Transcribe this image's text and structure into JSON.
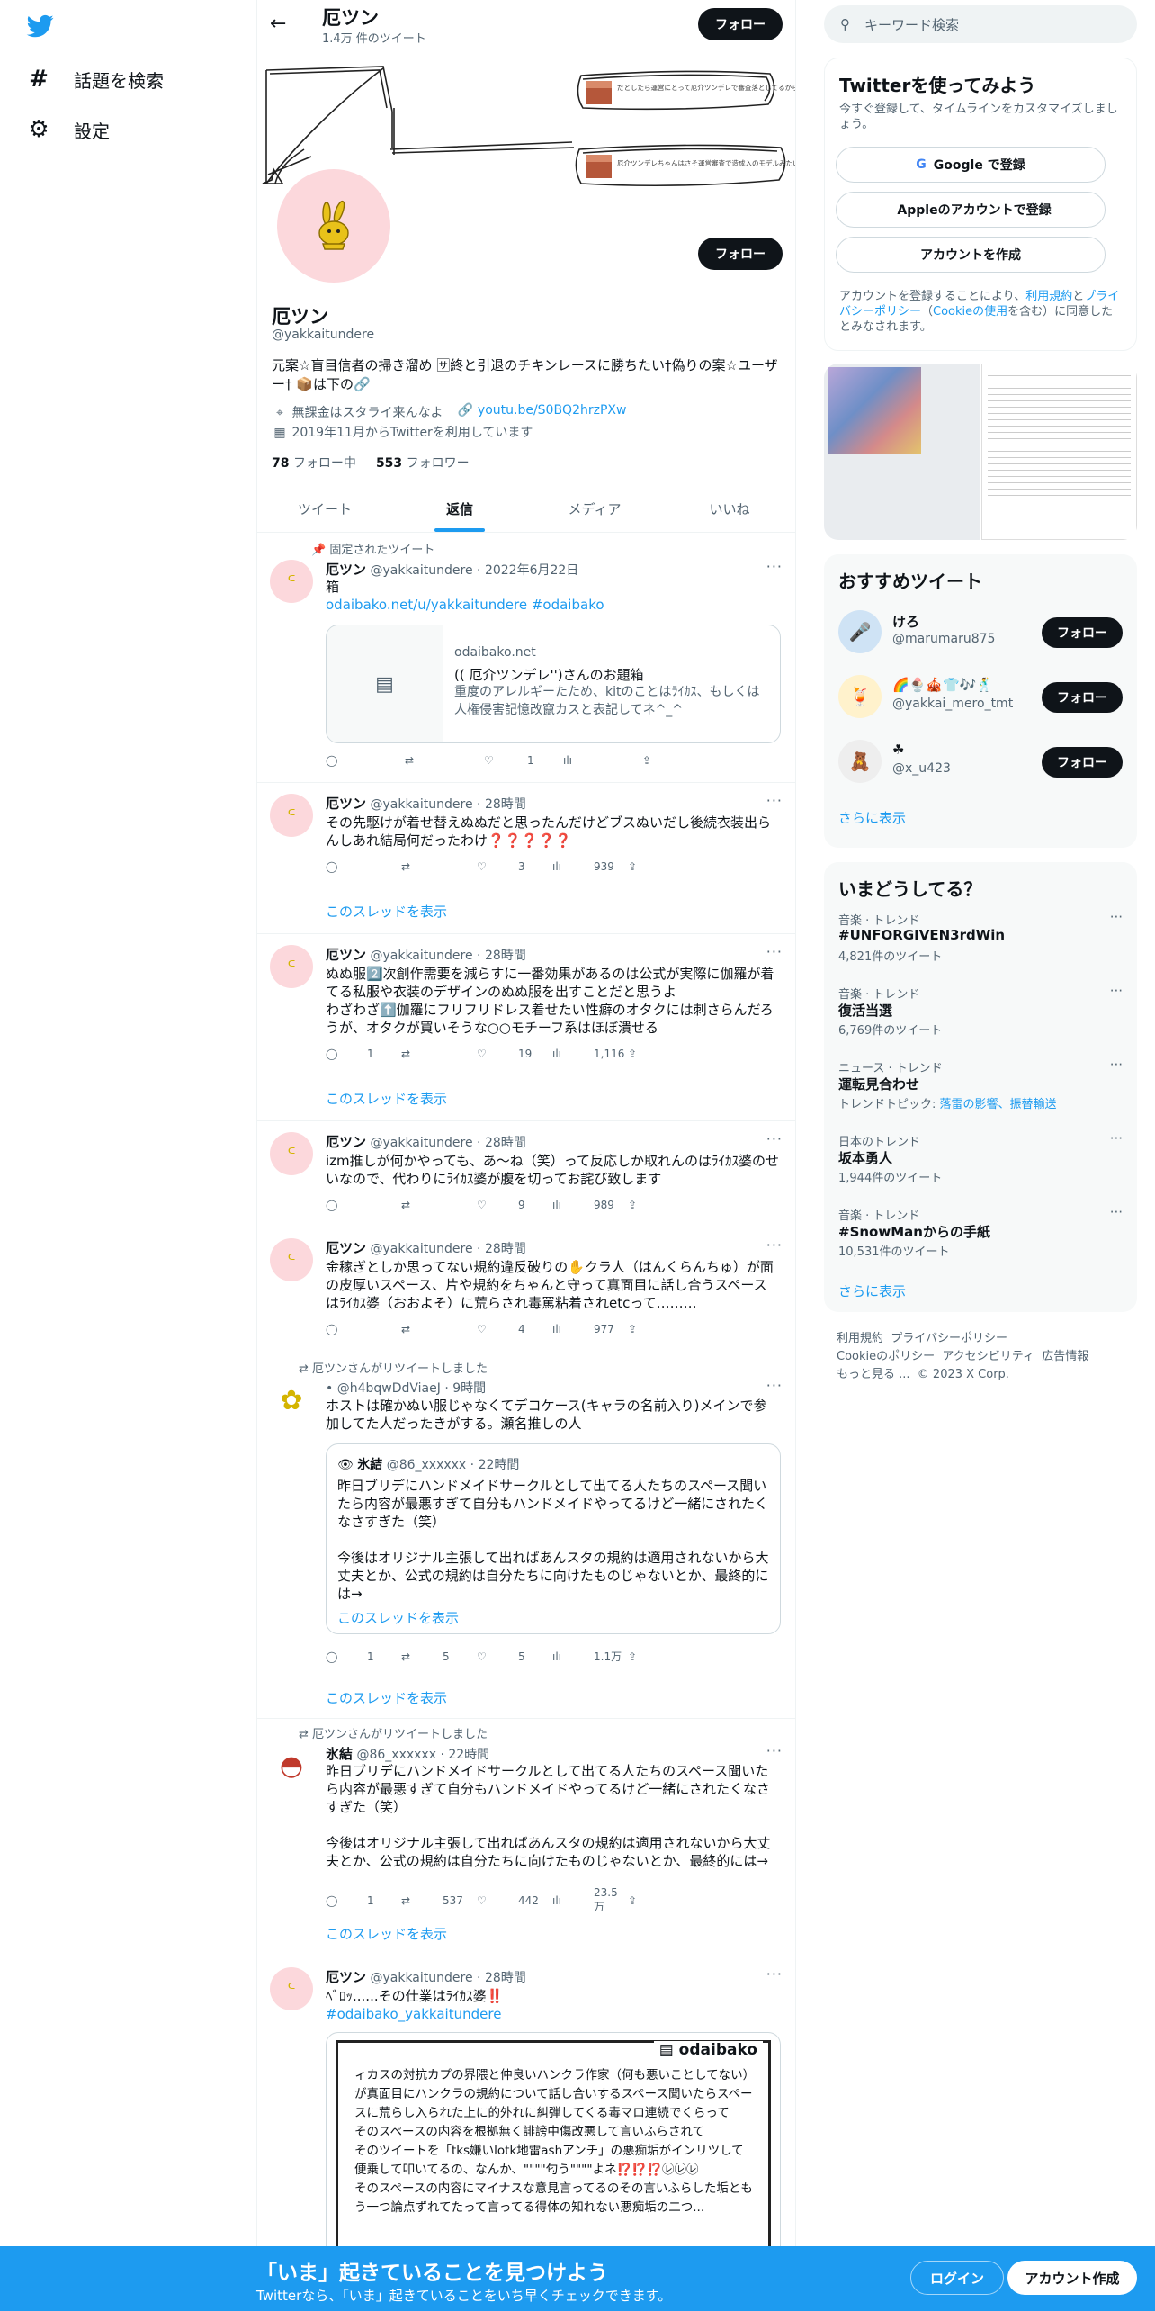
{
  "nav": {
    "items": [
      {
        "icon": "hashtag-icon",
        "glyph": "#",
        "label": "話題を検索"
      },
      {
        "icon": "gear-icon",
        "glyph": "⚙",
        "label": "設定"
      }
    ]
  },
  "header": {
    "name": "厄ツン",
    "tweet_count": "1.4万 件のツイート",
    "follow": "フォロー"
  },
  "banner": {
    "text1": "だとしたら運営にとって厄介ツンデレで審査落としてるから運営に晒はないか一笑",
    "text2": "厄介ツンデレちゃんはさそ運営審査で造成入のモデルみたいな運営が居らなのかもしれ"
  },
  "profile": {
    "avatar_glyph": "ᒼ",
    "name": "厄ツン",
    "handle": "@yakkaitundere",
    "follow": "フォロー",
    "bio": "元案☆盲目信者の掃き溜め 🈂終と引退のチキンレースに勝ちたい†偽りの案☆ユーザー† 📦は下の🔗",
    "location": "無課金はスタライ来んなよ",
    "url": "youtu.be/S0BQ2hrzPXw",
    "joined": "2019年11月からTwitterを利用しています",
    "following_count": "78",
    "following_label": "フォロー中",
    "followers_count": "553",
    "followers_label": "フォロワー"
  },
  "tabs": [
    "ツイート",
    "返信",
    "メディア",
    "いいね"
  ],
  "tweets": [
    {
      "context": "固定されたツイート",
      "name": "厄ツン",
      "handle": "@yakkaitundere",
      "time": "2022年6月22日",
      "text": "箱",
      "links": "odaibako.net/u/yakkaitundere #odaibako",
      "card": {
        "domain": "odaibako.net",
        "title": "(( 厄介ツンデレ'')さんのお題箱",
        "desc": "重度のアレルギーたため、kitのことはﾗｲｶｽ、もしくは人権侵害記憶改竄カスと表記してネ^_^"
      },
      "replies": "",
      "retweets": "",
      "likes": "1",
      "views": ""
    },
    {
      "name": "厄ツン",
      "handle": "@yakkaitundere",
      "time": "28時間",
      "text": "その先駆けが着せ替えぬぬだと思ったんだけどブスぬいだし後続衣装出らんしあれ結局何だったわけ❓❓❓❓❓",
      "replies": "",
      "retweets": "",
      "likes": "3",
      "views": "939",
      "thread": "このスレッドを表示"
    },
    {
      "name": "厄ツン",
      "handle": "@yakkaitundere",
      "time": "28時間",
      "text": "ぬぬ服2️⃣次創作需要を減らすに一番効果があるのは公式が実際に伽羅が着てる私服や衣装のデザインのぬぬ服を出すことだと思うよ\nわざわざ⬆️伽羅にフリフリドレス着せたい性癖のオタクには刺さらんだろうが、オタクが買いそうな○○モチーフ系はほぼ潰せる",
      "replies": "1",
      "retweets": "",
      "likes": "19",
      "views": "1,116",
      "thread": "このスレッドを表示"
    },
    {
      "name": "厄ツン",
      "handle": "@yakkaitundere",
      "time": "28時間",
      "text": "izm推しが何かやっても、あ〜ね（笑）って反応しか取れんのはﾗｲｶｽ婆のせいなので、代わりにﾗｲｶｽ婆が腹を切ってお詫び致します",
      "replies": "",
      "retweets": "",
      "likes": "9",
      "views": "989"
    },
    {
      "name": "厄ツン",
      "handle": "@yakkaitundere",
      "time": "28時間",
      "text": "金稼ぎとしか思ってない規約違反破りの✋クラ人（はんくらんちゅ）が面の皮厚いスペース、片や規約をちゃんと守って真面目に話し合うスペースはﾗｲｶｽ婆（おおよそ）に荒らされ毒罵粘着されetcって………",
      "replies": "",
      "retweets": "",
      "likes": "4",
      "views": "977"
    },
    {
      "context": "厄ツンさんがリツイートしました",
      "name": "",
      "handle": "@h4bqwDdViaeJ",
      "time": "9時間",
      "text": "ホストは確かぬい服じゃなくてデコケース(キャラの名前入り)メインで参加してた人だったきがする。瀬名推しの人",
      "quote": {
        "name": "氷結",
        "handle": "@86_xxxxxx",
        "time": "22時間",
        "text": "昨日ブリデにハンドメイドサークルとして出てる人たちのスペース聞いたら内容が最悪すぎて自分もハンドメイドやってるけど一緒にされたくなさすぎた（笑）\n\n今後はオリジナル主張して出ればあんスタの規約は適用されないから大丈夫とか、公式の規約は自分たちに向けたものじゃないとか、最終的には→",
        "thread": "このスレッドを表示"
      },
      "replies": "1",
      "retweets": "5",
      "likes": "5",
      "views": "1.1万",
      "thread": "このスレッドを表示"
    },
    {
      "context": "厄ツンさんがリツイートしました",
      "name": "氷結",
      "handle": "@86_xxxxxx",
      "time": "22時間",
      "text": "昨日ブリデにハンドメイドサークルとして出てる人たちのスペース聞いたら内容が最悪すぎて自分もハンドメイドやってるけど一緒にされたくなさすぎた（笑）\n\n今後はオリジナル主張して出ればあんスタの規約は適用されないから大丈夫とか、公式の規約は自分たちに向けたものじゃないとか、最終的には→",
      "replies": "1",
      "retweets": "537",
      "likes": "442",
      "views": "23.5万",
      "thread": "このスレッドを表示"
    },
    {
      "name": "厄ツン",
      "handle": "@yakkaitundere",
      "time": "28時間",
      "text": "ﾍﾞﾛｯ......その仕業はﾗｲｶｽ婆‼️",
      "links": "#odaibako_yakkaitundere",
      "image_brand": "odaibako",
      "image_text": "ィカスの対抗カプの界隈と仲良いハンクラ作家（何も悪いことしてない）が真面目にハンクラの規約について話し合いするスペース聞いたらスペースに荒らし入られた上に的外れに糾弾してくる毒マロ連続でくらって\nそのスペースの内容を根拠無く誹謗中傷改悪して言いふらされて\nそのツイートを「tks嫌いlotk地雷ashアンチ」の悪痴垢がインリツして便乗して叩いてるの、なんか、\"\"\"\"匂う\"\"\"\"よネ⁉️⁉️⁉️㋹㋹㋹\nそのスペースの内容にマイナスな意見言ってるのその言いふらした垢ともう一つ論点ずれてたって言ってる得体の知れない悪痴垢の二つ..."
    }
  ],
  "right": {
    "search_placeholder": "キーワード検索",
    "signup_box": {
      "title": "Twitterを使ってみよう",
      "subtitle": "今すぐ登録して、タイムラインをカスタマイズしましょう。",
      "google": "Google で登録",
      "apple": "Appleのアカウントで登録",
      "create": "アカウントを作成",
      "terms_prefix": "アカウントを登録することにより、",
      "terms_link1": "利用規約",
      "terms_and": "と",
      "terms_link2": "プライバシーポリシー",
      "terms_paren": "（",
      "terms_link3": "Cookieの使用",
      "terms_suffix": "を含む）に同意したとみなされます。"
    },
    "suggest": {
      "title": "おすすめツイート",
      "users": [
        {
          "name": "けろ",
          "handle": "@marumaru875",
          "avatar": "🎤",
          "bg": "#cfe3f5"
        },
        {
          "name": "🌈🍨🎪👕🎶🕺",
          "handle": "@yakkai_mero_tmt",
          "avatar": "🍹",
          "bg": "#fff2cc"
        },
        {
          "name": "☘",
          "handle": "@x_u423",
          "avatar": "🧸",
          "bg": "#eee"
        }
      ],
      "follow": "フォロー",
      "more": "さらに表示"
    },
    "trends": {
      "title": "いまどうしてる？",
      "items": [
        {
          "meta": "音楽 · トレンド",
          "name": "#UNFORGIVEN3rdWin",
          "count": "4,821件のツイート"
        },
        {
          "meta": "音楽 · トレンド",
          "name": "復活当選",
          "count": "6,769件のツイート"
        },
        {
          "meta": "ニュース · トレンド",
          "name": "運転見合わせ",
          "count_prefix": "トレンドトピック: ",
          "count_link": "落雷の影響、振替輸送"
        },
        {
          "meta": "日本のトレンド",
          "name": "坂本勇人",
          "count": "1,944件のツイート"
        },
        {
          "meta": "音楽 · トレンド",
          "name": "#SnowManからの手紙",
          "count": "10,531件のツイート"
        }
      ],
      "more": "さらに表示"
    },
    "footer": {
      "links1": [
        "利用規約",
        "プライバシーポリシー"
      ],
      "links2": [
        "Cookieのポリシー",
        "アクセシビリティ",
        "広告情報"
      ],
      "links3": [
        "もっと見る ...",
        "© 2023 X Corp."
      ]
    }
  },
  "bottom": {
    "title": "「いま」起きていることを見つけよう",
    "subtitle": "Twitterなら、「いま」起きていることをいち早くチェックできます。",
    "login": "ログイン",
    "signup": "アカウント作成"
  },
  "colors": {
    "accent": "#1d9bf0",
    "text": "#0f1419",
    "muted": "#536471",
    "bar": "#1d9bf0"
  }
}
